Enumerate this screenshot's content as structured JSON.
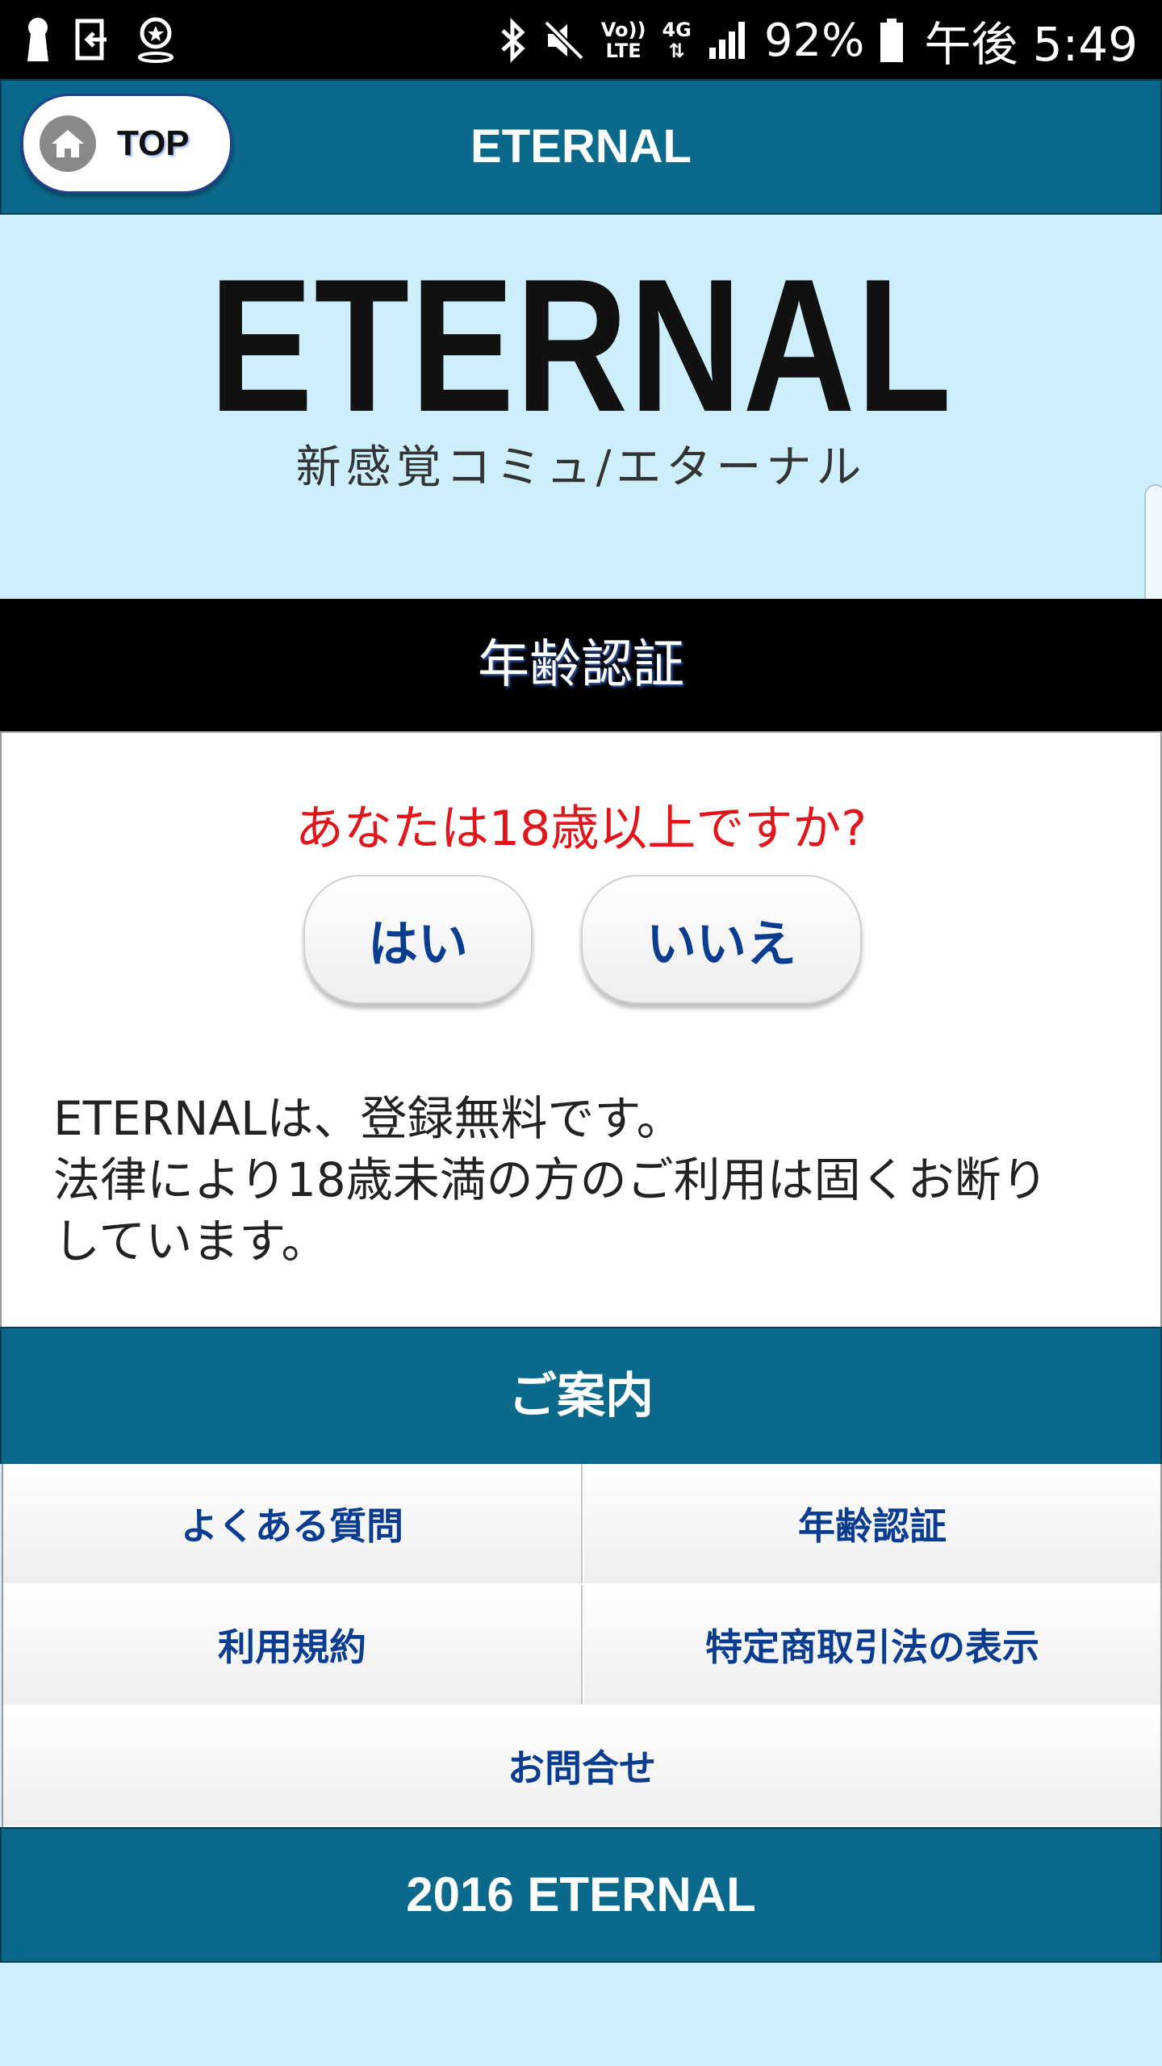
{
  "status_bar": {
    "volte_top": "Vo))",
    "volte_bottom": "LTE",
    "network": "4G",
    "battery": "92%",
    "time": "午後 5:49"
  },
  "header": {
    "top_label": "TOP",
    "title": "ETERNAL"
  },
  "logo": {
    "main": "ETERNAL",
    "sub": "新感覚コミュ/エターナル"
  },
  "age_verification": {
    "title": "年齢認証",
    "question": "あなたは18歳以上ですか?",
    "yes_label": "はい",
    "no_label": "いいえ",
    "notice_lines": [
      "ETERNALは、登録無料です。",
      "法律により18歳未満の方のご利用は固くお断り",
      "しています。"
    ]
  },
  "info": {
    "title": "ご案内",
    "links": [
      "よくある質問",
      "年齢認証",
      "利用規約",
      "特定商取引法の表示",
      "お問合せ"
    ]
  },
  "footer": {
    "copyright": "2016 ETERNAL"
  },
  "colors": {
    "header_bg": "#0b6a8b",
    "page_bg": "#cdeffb",
    "question_red": "#e0161b",
    "link_blue": "#0a3d8f"
  }
}
